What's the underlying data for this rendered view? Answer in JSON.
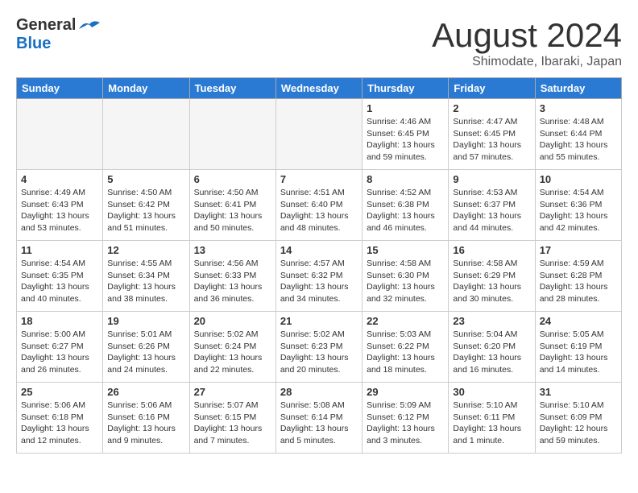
{
  "header": {
    "logo_general": "General",
    "logo_blue": "Blue",
    "month_title": "August 2024",
    "location": "Shimodate, Ibaraki, Japan"
  },
  "weekdays": [
    "Sunday",
    "Monday",
    "Tuesday",
    "Wednesday",
    "Thursday",
    "Friday",
    "Saturday"
  ],
  "weeks": [
    [
      {
        "day": "",
        "info": ""
      },
      {
        "day": "",
        "info": ""
      },
      {
        "day": "",
        "info": ""
      },
      {
        "day": "",
        "info": ""
      },
      {
        "day": "1",
        "info": "Sunrise: 4:46 AM\nSunset: 6:45 PM\nDaylight: 13 hours\nand 59 minutes."
      },
      {
        "day": "2",
        "info": "Sunrise: 4:47 AM\nSunset: 6:45 PM\nDaylight: 13 hours\nand 57 minutes."
      },
      {
        "day": "3",
        "info": "Sunrise: 4:48 AM\nSunset: 6:44 PM\nDaylight: 13 hours\nand 55 minutes."
      }
    ],
    [
      {
        "day": "4",
        "info": "Sunrise: 4:49 AM\nSunset: 6:43 PM\nDaylight: 13 hours\nand 53 minutes."
      },
      {
        "day": "5",
        "info": "Sunrise: 4:50 AM\nSunset: 6:42 PM\nDaylight: 13 hours\nand 51 minutes."
      },
      {
        "day": "6",
        "info": "Sunrise: 4:50 AM\nSunset: 6:41 PM\nDaylight: 13 hours\nand 50 minutes."
      },
      {
        "day": "7",
        "info": "Sunrise: 4:51 AM\nSunset: 6:40 PM\nDaylight: 13 hours\nand 48 minutes."
      },
      {
        "day": "8",
        "info": "Sunrise: 4:52 AM\nSunset: 6:38 PM\nDaylight: 13 hours\nand 46 minutes."
      },
      {
        "day": "9",
        "info": "Sunrise: 4:53 AM\nSunset: 6:37 PM\nDaylight: 13 hours\nand 44 minutes."
      },
      {
        "day": "10",
        "info": "Sunrise: 4:54 AM\nSunset: 6:36 PM\nDaylight: 13 hours\nand 42 minutes."
      }
    ],
    [
      {
        "day": "11",
        "info": "Sunrise: 4:54 AM\nSunset: 6:35 PM\nDaylight: 13 hours\nand 40 minutes."
      },
      {
        "day": "12",
        "info": "Sunrise: 4:55 AM\nSunset: 6:34 PM\nDaylight: 13 hours\nand 38 minutes."
      },
      {
        "day": "13",
        "info": "Sunrise: 4:56 AM\nSunset: 6:33 PM\nDaylight: 13 hours\nand 36 minutes."
      },
      {
        "day": "14",
        "info": "Sunrise: 4:57 AM\nSunset: 6:32 PM\nDaylight: 13 hours\nand 34 minutes."
      },
      {
        "day": "15",
        "info": "Sunrise: 4:58 AM\nSunset: 6:30 PM\nDaylight: 13 hours\nand 32 minutes."
      },
      {
        "day": "16",
        "info": "Sunrise: 4:58 AM\nSunset: 6:29 PM\nDaylight: 13 hours\nand 30 minutes."
      },
      {
        "day": "17",
        "info": "Sunrise: 4:59 AM\nSunset: 6:28 PM\nDaylight: 13 hours\nand 28 minutes."
      }
    ],
    [
      {
        "day": "18",
        "info": "Sunrise: 5:00 AM\nSunset: 6:27 PM\nDaylight: 13 hours\nand 26 minutes."
      },
      {
        "day": "19",
        "info": "Sunrise: 5:01 AM\nSunset: 6:26 PM\nDaylight: 13 hours\nand 24 minutes."
      },
      {
        "day": "20",
        "info": "Sunrise: 5:02 AM\nSunset: 6:24 PM\nDaylight: 13 hours\nand 22 minutes."
      },
      {
        "day": "21",
        "info": "Sunrise: 5:02 AM\nSunset: 6:23 PM\nDaylight: 13 hours\nand 20 minutes."
      },
      {
        "day": "22",
        "info": "Sunrise: 5:03 AM\nSunset: 6:22 PM\nDaylight: 13 hours\nand 18 minutes."
      },
      {
        "day": "23",
        "info": "Sunrise: 5:04 AM\nSunset: 6:20 PM\nDaylight: 13 hours\nand 16 minutes."
      },
      {
        "day": "24",
        "info": "Sunrise: 5:05 AM\nSunset: 6:19 PM\nDaylight: 13 hours\nand 14 minutes."
      }
    ],
    [
      {
        "day": "25",
        "info": "Sunrise: 5:06 AM\nSunset: 6:18 PM\nDaylight: 13 hours\nand 12 minutes."
      },
      {
        "day": "26",
        "info": "Sunrise: 5:06 AM\nSunset: 6:16 PM\nDaylight: 13 hours\nand 9 minutes."
      },
      {
        "day": "27",
        "info": "Sunrise: 5:07 AM\nSunset: 6:15 PM\nDaylight: 13 hours\nand 7 minutes."
      },
      {
        "day": "28",
        "info": "Sunrise: 5:08 AM\nSunset: 6:14 PM\nDaylight: 13 hours\nand 5 minutes."
      },
      {
        "day": "29",
        "info": "Sunrise: 5:09 AM\nSunset: 6:12 PM\nDaylight: 13 hours\nand 3 minutes."
      },
      {
        "day": "30",
        "info": "Sunrise: 5:10 AM\nSunset: 6:11 PM\nDaylight: 13 hours\nand 1 minute."
      },
      {
        "day": "31",
        "info": "Sunrise: 5:10 AM\nSunset: 6:09 PM\nDaylight: 12 hours\nand 59 minutes."
      }
    ]
  ]
}
